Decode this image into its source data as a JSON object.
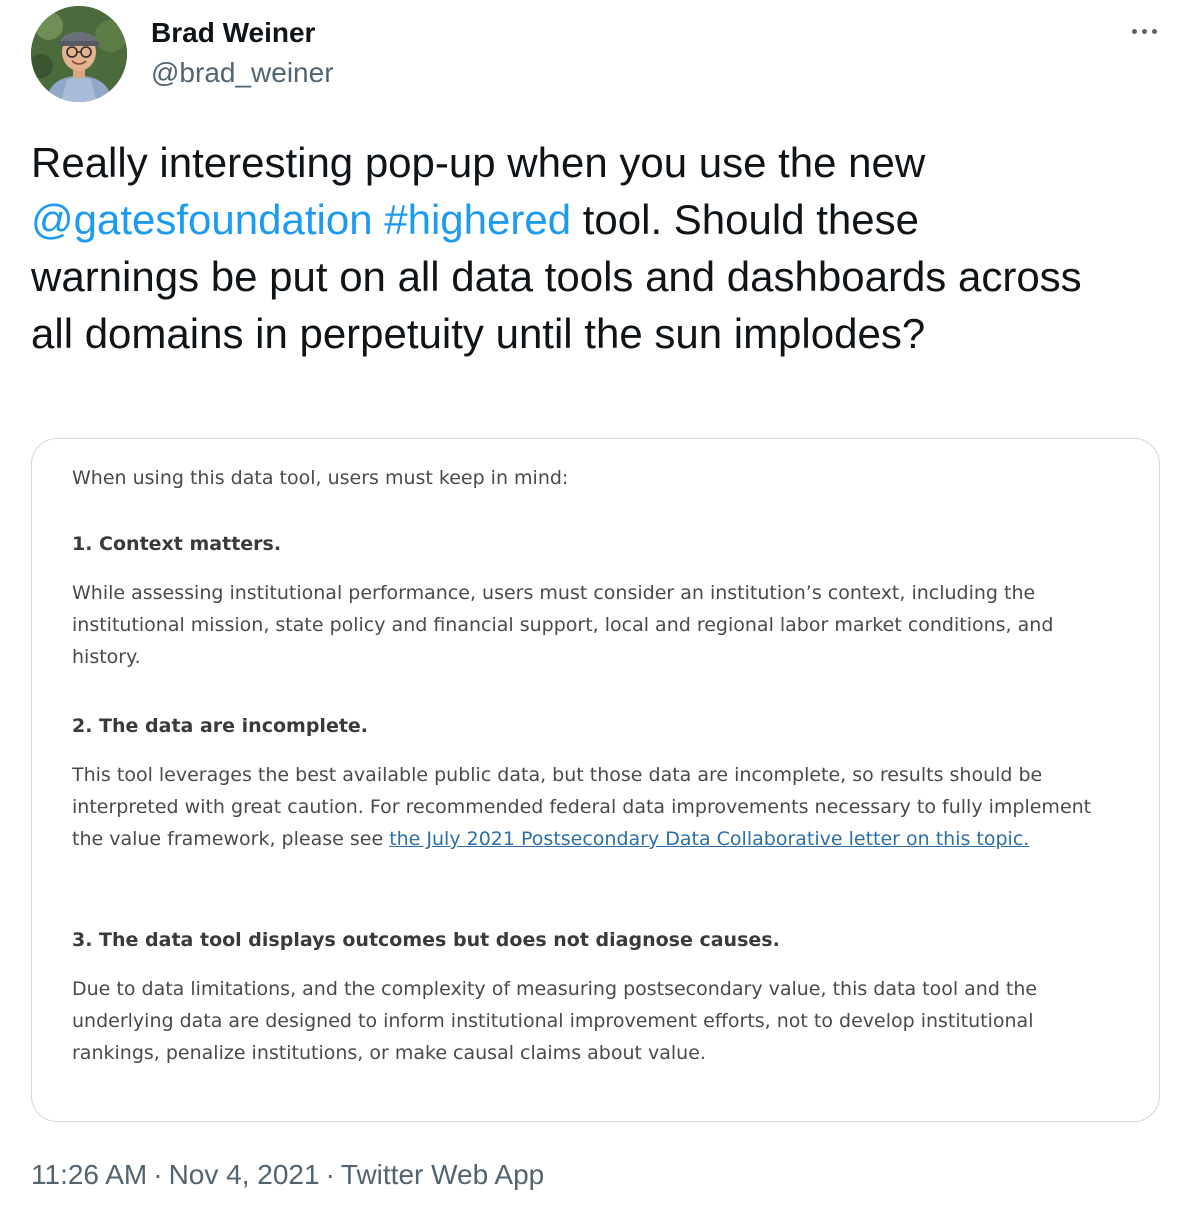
{
  "author": {
    "name": "Brad Weiner",
    "handle": "@brad_weiner"
  },
  "more_icon": "more-horizontal-icon",
  "tweet": {
    "text_part1": "Really interesting pop-up when you use the new ",
    "mention": "@gatesfoundation",
    "space": " ",
    "hashtag": "#highered",
    "text_part2": " tool. Should these warnings be put on all data tools and dashboards across all domains in perpetuity until the sun implodes?"
  },
  "card": {
    "intro": "When using this data tool, users must keep in mind:",
    "section1_heading": "1. Context matters.",
    "section1_body": "While assessing institutional performance, users must consider an institution’s context, including the institutional mission, state policy and financial support, local and regional labor market conditions, and history.",
    "section2_heading": "2. The data are incomplete.",
    "section2_body": "This tool leverages the best available public data, but those data are incomplete, so results should be interpreted with great caution. For recommended federal data improvements necessary to fully implement the value framework, please see ",
    "section2_link": "the July 2021 Postsecondary Data Collaborative letter on this topic.",
    "section3_heading": "3. The data tool displays outcomes but does not diagnose causes.",
    "section3_body": "Due to data limitations, and the complexity of measuring postsecondary value, this data tool and the underlying data are designed to inform institutional improvement efforts, not to develop institutional rankings, penalize institutions, or make causal claims about value."
  },
  "footer": {
    "time": "11:26 AM",
    "separator": "·",
    "date": "Nov 4, 2021",
    "source": "Twitter Web App"
  },
  "colors": {
    "link": "#1d9bf0",
    "secondary_text": "#536471",
    "primary_text": "#0f1419",
    "card_border": "#cfd9de",
    "card_link": "#2c6fa8"
  }
}
